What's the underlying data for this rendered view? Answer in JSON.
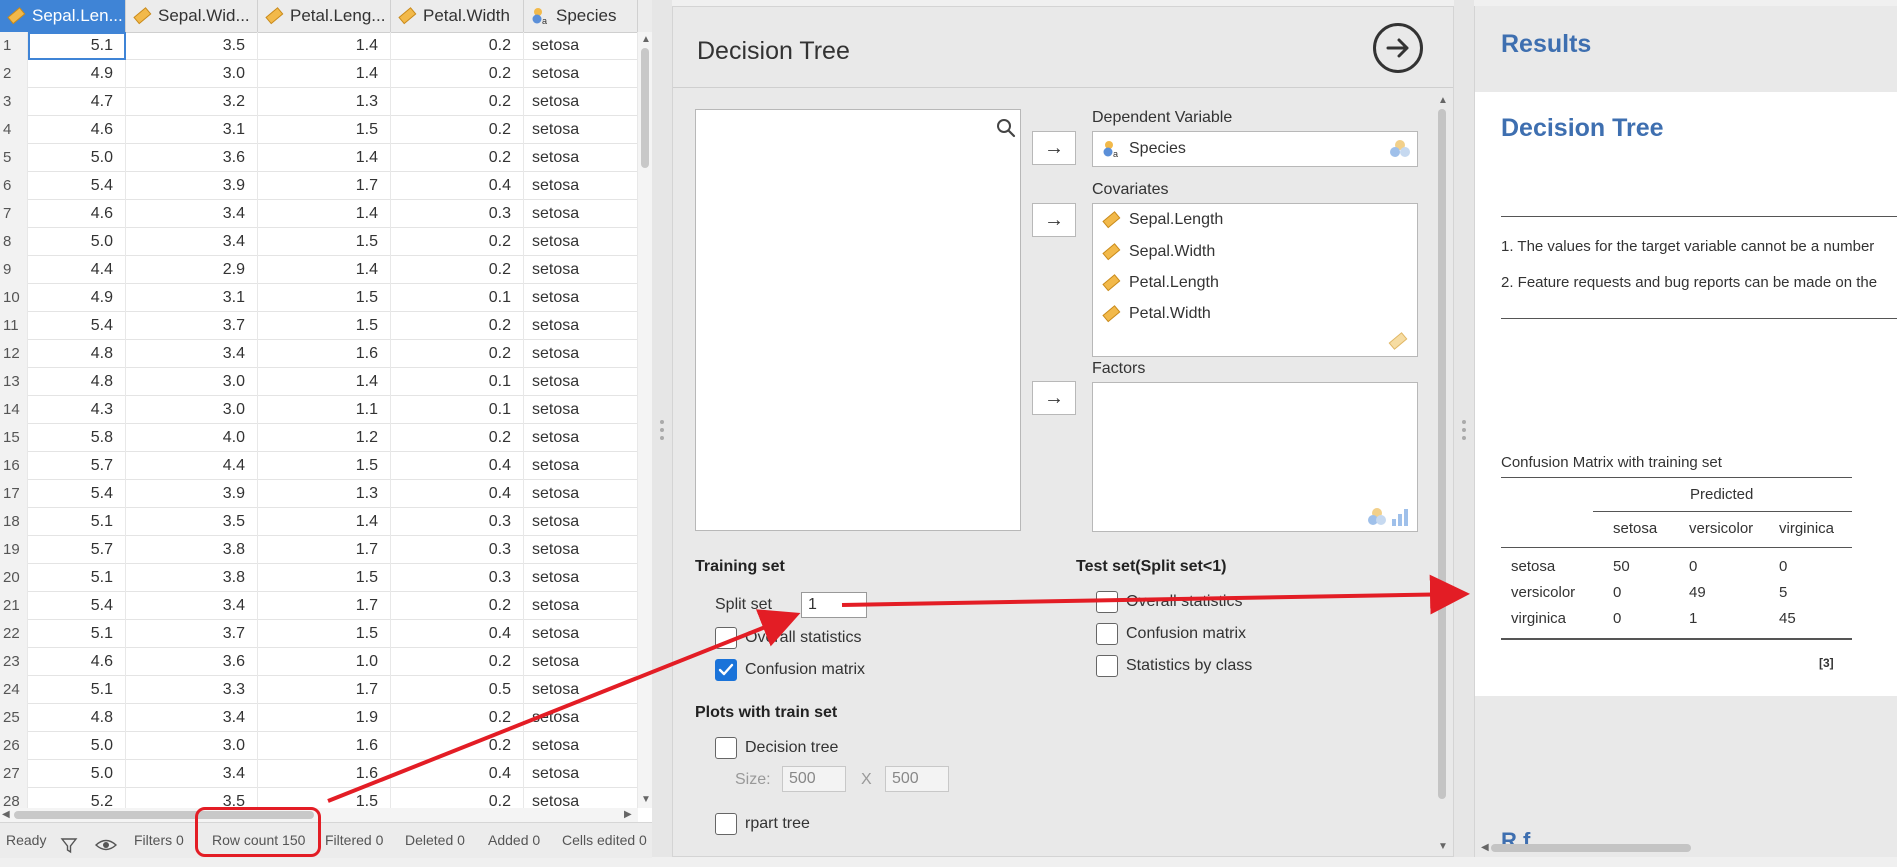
{
  "spreadsheet": {
    "columns": [
      {
        "name": "Sepal.Len...",
        "icon": "ruler-icon",
        "selected": true
      },
      {
        "name": "Sepal.Wid...",
        "icon": "ruler-icon",
        "selected": false
      },
      {
        "name": "Petal.Leng...",
        "icon": "ruler-icon",
        "selected": false
      },
      {
        "name": "Petal.Width",
        "icon": "ruler-icon",
        "selected": false
      },
      {
        "name": "Species",
        "icon": "nominal-text-icon",
        "selected": false
      }
    ],
    "rows": [
      [
        "1",
        "5.1",
        "3.5",
        "1.4",
        "0.2",
        "setosa"
      ],
      [
        "2",
        "4.9",
        "3.0",
        "1.4",
        "0.2",
        "setosa"
      ],
      [
        "3",
        "4.7",
        "3.2",
        "1.3",
        "0.2",
        "setosa"
      ],
      [
        "4",
        "4.6",
        "3.1",
        "1.5",
        "0.2",
        "setosa"
      ],
      [
        "5",
        "5.0",
        "3.6",
        "1.4",
        "0.2",
        "setosa"
      ],
      [
        "6",
        "5.4",
        "3.9",
        "1.7",
        "0.4",
        "setosa"
      ],
      [
        "7",
        "4.6",
        "3.4",
        "1.4",
        "0.3",
        "setosa"
      ],
      [
        "8",
        "5.0",
        "3.4",
        "1.5",
        "0.2",
        "setosa"
      ],
      [
        "9",
        "4.4",
        "2.9",
        "1.4",
        "0.2",
        "setosa"
      ],
      [
        "10",
        "4.9",
        "3.1",
        "1.5",
        "0.1",
        "setosa"
      ],
      [
        "11",
        "5.4",
        "3.7",
        "1.5",
        "0.2",
        "setosa"
      ],
      [
        "12",
        "4.8",
        "3.4",
        "1.6",
        "0.2",
        "setosa"
      ],
      [
        "13",
        "4.8",
        "3.0",
        "1.4",
        "0.1",
        "setosa"
      ],
      [
        "14",
        "4.3",
        "3.0",
        "1.1",
        "0.1",
        "setosa"
      ],
      [
        "15",
        "5.8",
        "4.0",
        "1.2",
        "0.2",
        "setosa"
      ],
      [
        "16",
        "5.7",
        "4.4",
        "1.5",
        "0.4",
        "setosa"
      ],
      [
        "17",
        "5.4",
        "3.9",
        "1.3",
        "0.4",
        "setosa"
      ],
      [
        "18",
        "5.1",
        "3.5",
        "1.4",
        "0.3",
        "setosa"
      ],
      [
        "19",
        "5.7",
        "3.8",
        "1.7",
        "0.3",
        "setosa"
      ],
      [
        "20",
        "5.1",
        "3.8",
        "1.5",
        "0.3",
        "setosa"
      ],
      [
        "21",
        "5.4",
        "3.4",
        "1.7",
        "0.2",
        "setosa"
      ],
      [
        "22",
        "5.1",
        "3.7",
        "1.5",
        "0.4",
        "setosa"
      ],
      [
        "23",
        "4.6",
        "3.6",
        "1.0",
        "0.2",
        "setosa"
      ],
      [
        "24",
        "5.1",
        "3.3",
        "1.7",
        "0.5",
        "setosa"
      ],
      [
        "25",
        "4.8",
        "3.4",
        "1.9",
        "0.2",
        "setosa"
      ],
      [
        "26",
        "5.0",
        "3.0",
        "1.6",
        "0.2",
        "setosa"
      ],
      [
        "27",
        "5.0",
        "3.4",
        "1.6",
        "0.4",
        "setosa"
      ],
      [
        "28",
        "5.2",
        "3.5",
        "1.5",
        "0.2",
        "setosa"
      ]
    ],
    "status": {
      "ready": "Ready",
      "filters": "Filters 0",
      "row_count": "Row count 150",
      "filtered": "Filtered 0",
      "deleted": "Deleted 0",
      "added": "Added 0",
      "cells_edited": "Cells edited 0"
    }
  },
  "options": {
    "title": "Decision Tree",
    "run_icon": "arrow-right-circle-icon",
    "dependent_variable": {
      "label": "Dependent Variable",
      "value": "Species"
    },
    "covariates": {
      "label": "Covariates",
      "items": [
        "Sepal.Length",
        "Sepal.Width",
        "Petal.Length",
        "Petal.Width"
      ]
    },
    "factors": {
      "label": "Factors",
      "items": []
    },
    "move_button_glyph": "→",
    "training_set": {
      "label": "Training set",
      "split_label": "Split set",
      "split_value": "1",
      "overall_statistics": {
        "label": "Overall statistics",
        "checked": false
      },
      "confusion_matrix": {
        "label": "Confusion matrix",
        "checked": true
      }
    },
    "test_set": {
      "label": "Test set(Split set<1)",
      "overall_statistics": {
        "label": "Overall statistics",
        "checked": false
      },
      "confusion_matrix": {
        "label": "Confusion matrix",
        "checked": false
      },
      "statistics_by_class": {
        "label": "Statistics by class",
        "checked": false
      }
    },
    "plots": {
      "label": "Plots with train set",
      "decision_tree": {
        "label": "Decision tree",
        "checked": false
      },
      "size_label": "Size:",
      "size_width": "500",
      "size_x": "X",
      "size_height": "500",
      "rpart_tree": {
        "label": "rpart tree",
        "checked": false
      }
    }
  },
  "results": {
    "header": "Results",
    "analysis_title": "Decision Tree",
    "notes": [
      "1. The values for the target variable cannot be a number",
      "2. Feature requests and bug reports can be made on the"
    ],
    "confusion_matrix": {
      "caption": "Confusion Matrix with training set",
      "predicted_label": "Predicted",
      "columns": [
        "setosa",
        "versicolor",
        "virginica"
      ],
      "rows": [
        {
          "label": "setosa",
          "values": [
            "50",
            "0",
            "0"
          ]
        },
        {
          "label": "versicolor",
          "values": [
            "0",
            "49",
            "5"
          ]
        },
        {
          "label": "virginica",
          "values": [
            "0",
            "1",
            "45"
          ]
        }
      ],
      "reference": "[3]"
    }
  },
  "colors": {
    "accent": "#3f84d6",
    "results_title": "#3e6fb0",
    "annotation": "#e31d25",
    "checkbox_on": "#1a73d9"
  }
}
